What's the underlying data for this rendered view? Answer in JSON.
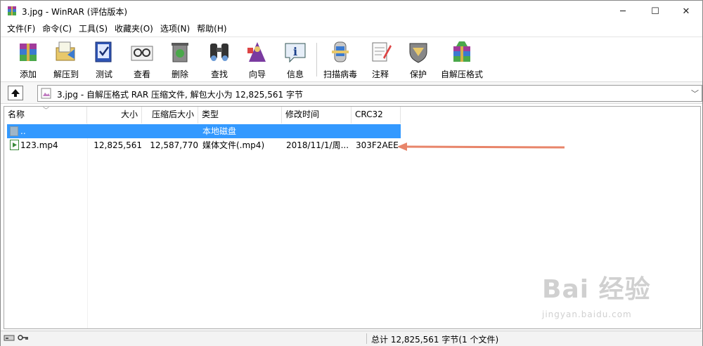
{
  "window": {
    "title": "3.jpg - WinRAR (评估版本)",
    "min_icon": "─",
    "max_icon": "☐",
    "close_icon": "✕"
  },
  "menu": [
    "文件(F)",
    "命令(C)",
    "工具(S)",
    "收藏夹(O)",
    "选项(N)",
    "帮助(H)"
  ],
  "toolbar": [
    {
      "label": "添加",
      "icon": "add-archive-icon"
    },
    {
      "label": "解压到",
      "icon": "extract-to-icon"
    },
    {
      "label": "测试",
      "icon": "test-icon"
    },
    {
      "label": "查看",
      "icon": "view-icon"
    },
    {
      "label": "删除",
      "icon": "delete-icon"
    },
    {
      "label": "查找",
      "icon": "find-icon"
    },
    {
      "label": "向导",
      "icon": "wizard-icon"
    },
    {
      "label": "信息",
      "icon": "info-icon"
    },
    {
      "label": "扫描病毒",
      "icon": "virus-scan-icon"
    },
    {
      "label": "注释",
      "icon": "comment-icon"
    },
    {
      "label": "保护",
      "icon": "protect-icon"
    },
    {
      "label": "自解压格式",
      "icon": "sfx-icon"
    }
  ],
  "address": {
    "path": "3.jpg - 自解压格式 RAR 压缩文件, 解包大小为 12,825,561 字节"
  },
  "columns": [
    "名称",
    "大小",
    "压缩后大小",
    "类型",
    "修改时间",
    "CRC32"
  ],
  "rows": [
    {
      "name": "..",
      "size": "",
      "packed": "",
      "type": "本地磁盘",
      "modified": "",
      "crc": "",
      "selected": true
    },
    {
      "name": "123.mp4",
      "size": "12,825,561",
      "packed": "12,587,770",
      "type": "媒体文件(.mp4)",
      "modified": "2018/11/1/周...",
      "crc": "303F2AEE",
      "selected": false
    }
  ],
  "status": {
    "text": "总计 12,825,561 字节(1 个文件)"
  },
  "watermark": {
    "main": "Bai 经验",
    "sub": "jingyan.baidu.com"
  },
  "colors": {
    "selection": "#3399ff",
    "annotation_arrow": "#e8856a"
  }
}
